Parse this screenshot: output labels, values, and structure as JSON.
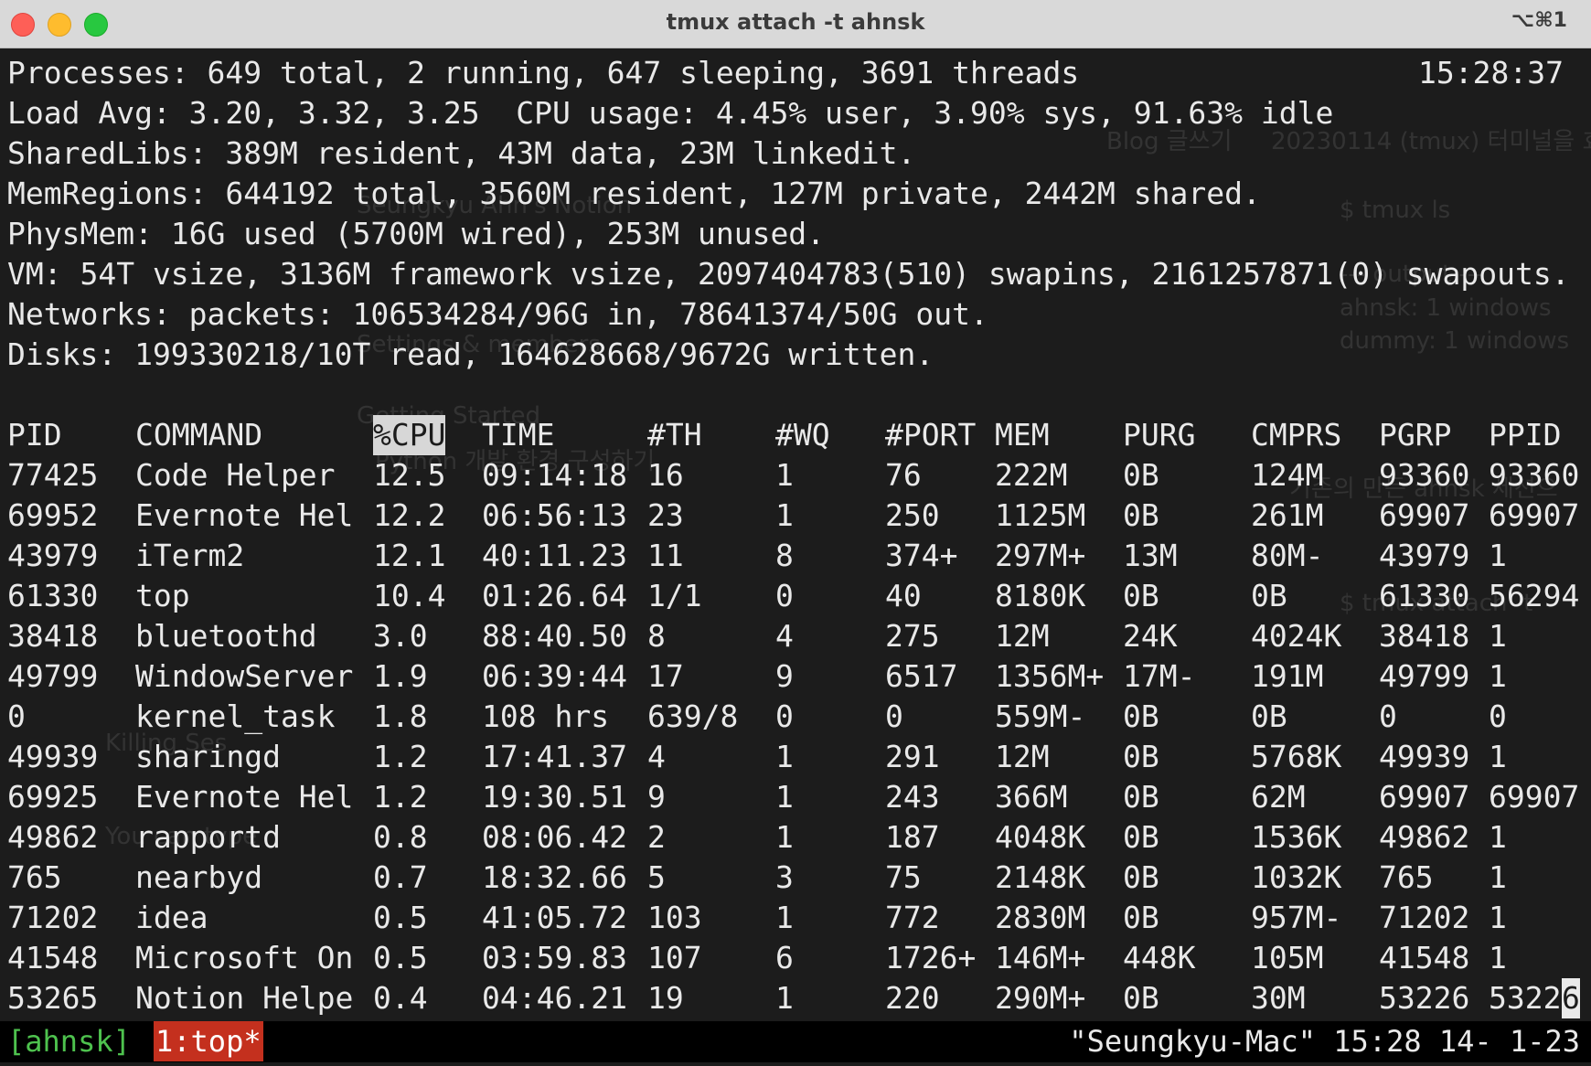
{
  "window": {
    "title": "tmux attach -t ahnsk",
    "shortcut": "⌥⌘1"
  },
  "summary": {
    "processes": "Processes: 649 total, 2 running, 647 sleeping, 3691 threads",
    "clock": "15:28:37",
    "load": "Load Avg: 3.20, 3.32, 3.25  CPU usage: 4.45% user, 3.90% sys, 91.63% idle",
    "sharedlibs": "SharedLibs: 389M resident, 43M data, 23M linkedit.",
    "memregions": "MemRegions: 644192 total, 3560M resident, 127M private, 2442M shared.",
    "physmem": "PhysMem: 16G used (5700M wired), 253M unused.",
    "vm": "VM: 54T vsize, 3136M framework vsize, 2097404783(510) swapins, 2161257871(0) swapouts.",
    "networks": "Networks: packets: 106534284/96G in, 78641374/50G out.",
    "disks": "Disks: 199330218/10T read, 164628668/9672G written."
  },
  "table": {
    "columns": [
      "PID",
      "COMMAND",
      "%CPU",
      "TIME",
      "#TH",
      "#WQ",
      "#PORT",
      "MEM",
      "PURG",
      "CMPRS",
      "PGRP",
      "PPID"
    ],
    "sorted_column": "%CPU",
    "rows": [
      [
        "77425",
        "Code Helper",
        "12.5",
        "09:14:18",
        "16",
        "1",
        "76",
        "222M",
        "0B",
        "124M",
        "93360",
        "93360"
      ],
      [
        "69952",
        "Evernote Hel",
        "12.2",
        "06:56:13",
        "23",
        "1",
        "250",
        "1125M",
        "0B",
        "261M",
        "69907",
        "69907"
      ],
      [
        "43979",
        "iTerm2",
        "12.1",
        "40:11.23",
        "11",
        "8",
        "374+",
        "297M+",
        "13M",
        "80M-",
        "43979",
        "1"
      ],
      [
        "61330",
        "top",
        "10.4",
        "01:26.64",
        "1/1",
        "0",
        "40",
        "8180K",
        "0B",
        "0B",
        "61330",
        "56294"
      ],
      [
        "38418",
        "bluetoothd",
        "3.0",
        "88:40.50",
        "8",
        "4",
        "275",
        "12M",
        "24K",
        "4024K",
        "38418",
        "1"
      ],
      [
        "49799",
        "WindowServer",
        "1.9",
        "06:39:44",
        "17",
        "9",
        "6517",
        "1356M+",
        "17M-",
        "191M",
        "49799",
        "1"
      ],
      [
        "0",
        "kernel_task",
        "1.8",
        "108 hrs",
        "639/8",
        "0",
        "0",
        "559M-",
        "0B",
        "0B",
        "0",
        "0"
      ],
      [
        "49939",
        "sharingd",
        "1.2",
        "17:41.37",
        "4",
        "1",
        "291",
        "12M",
        "0B",
        "5768K",
        "49939",
        "1"
      ],
      [
        "69925",
        "Evernote Hel",
        "1.2",
        "19:30.51",
        "9",
        "1",
        "243",
        "366M",
        "0B",
        "62M",
        "69907",
        "69907"
      ],
      [
        "49862",
        "rapportd",
        "0.8",
        "08:06.42",
        "2",
        "1",
        "187",
        "4048K",
        "0B",
        "1536K",
        "49862",
        "1"
      ],
      [
        "765",
        "nearbyd",
        "0.7",
        "18:32.66",
        "5",
        "3",
        "75",
        "2148K",
        "0B",
        "1032K",
        "765",
        "1"
      ],
      [
        "71202",
        "idea",
        "0.5",
        "41:05.72",
        "103",
        "1",
        "772",
        "2830M",
        "0B",
        "957M-",
        "71202",
        "1"
      ],
      [
        "41548",
        "Microsoft On",
        "0.5",
        "03:59.83",
        "107",
        "6",
        "1726+",
        "146M+",
        "448K",
        "105M",
        "41548",
        "1"
      ],
      [
        "53265",
        "Notion Helpe",
        "0.4",
        "04:46.21",
        "19",
        "1",
        "220",
        "290M+",
        "0B",
        "30M",
        "53226",
        "5322"
      ]
    ],
    "last_cursor_char": "6"
  },
  "statusbar": {
    "session": "[ahnsk]",
    "window": "1:top*",
    "host": "\"Seungkyu-Mac\" 15:28 14- 1-23"
  },
  "background_ghost": [
    "Seungkyu Ahn's Notion",
    "Blog 글쓰기",
    "20230114 (tmux) 터미널을 효",
    "$ tmux ls",
    "--- output ---",
    "ahnsk: 1 windows",
    "dummy: 1 windows",
    "Settings & members",
    "Getting Started",
    "Python 개발 환경 구성하기",
    "기존의 만든 ahnsk 세션으",
    "$ tmux attach -t",
    "Killing Ses",
    "You can type"
  ],
  "colors": {
    "session_green": "#4ec24e",
    "window_red": "#c4301e",
    "terminal_bg": "#1c1c1c",
    "text": "#e9e9e9"
  }
}
